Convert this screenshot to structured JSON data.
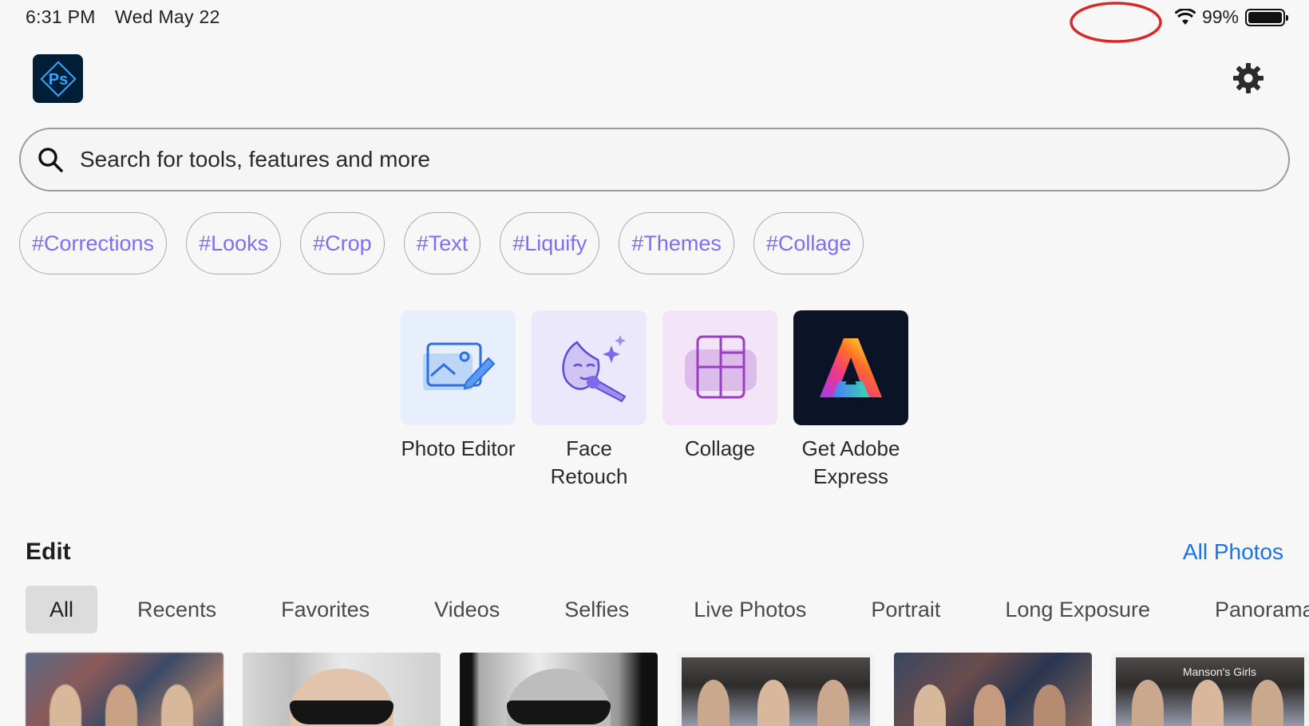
{
  "status_bar": {
    "time": "6:31 PM",
    "date": "Wed May 22",
    "battery": "99%",
    "battery_level": 0.99
  },
  "header": {
    "logo_text": "Ps",
    "settings_icon": "gear-icon"
  },
  "search": {
    "placeholder": "Search for tools, features and more"
  },
  "tags": [
    "#Corrections",
    "#Looks",
    "#Crop",
    "#Text",
    "#Liquify",
    "#Themes",
    "#Collage"
  ],
  "tools": [
    {
      "label": "Photo Editor",
      "icon": "photo-editor-icon"
    },
    {
      "label": "Face\nRetouch",
      "icon": "face-retouch-icon"
    },
    {
      "label": "Collage",
      "icon": "collage-icon"
    },
    {
      "label": "Get Adobe\nExpress",
      "icon": "adobe-express-icon"
    }
  ],
  "edit": {
    "title": "Edit",
    "all_photos": "All Photos",
    "filters": [
      "All",
      "Recents",
      "Favorites",
      "Videos",
      "Selfies",
      "Live Photos",
      "Portrait",
      "Long Exposure",
      "Panorama"
    ],
    "active_filter": "All",
    "thumbnail_caption": "Manson's Girls"
  },
  "colors": {
    "tag_text": "#7f6ef0",
    "link": "#1a73e8",
    "ps_logo_bg": "#001e36",
    "ps_logo_accent": "#31a8ff",
    "annotation": "#d42a2a"
  }
}
